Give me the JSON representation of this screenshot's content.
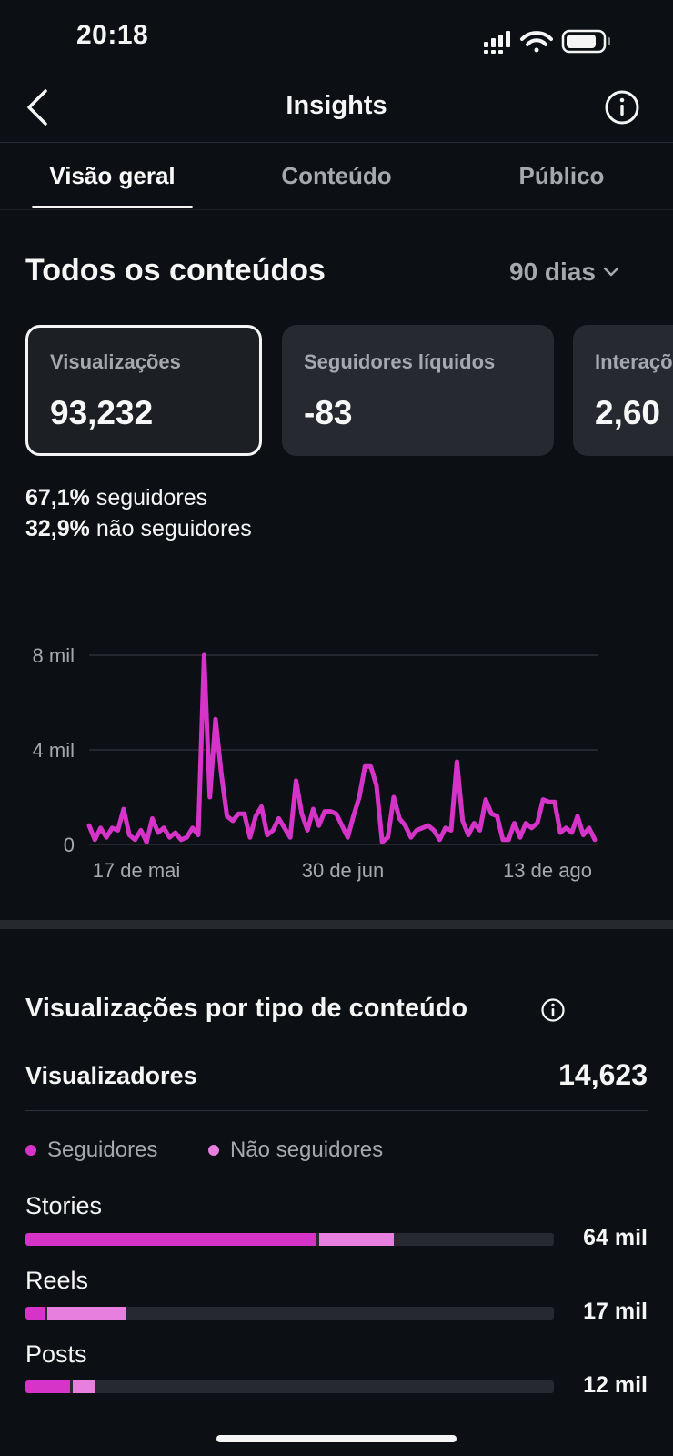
{
  "status_bar": {
    "time": "20:18"
  },
  "header": {
    "title": "Insights"
  },
  "tabs": [
    {
      "label": "Visão geral",
      "active": true
    },
    {
      "label": "Conteúdo",
      "active": false
    },
    {
      "label": "Público",
      "active": false
    }
  ],
  "overview": {
    "title": "Todos os conteúdos",
    "period": "90 dias",
    "cards": [
      {
        "label": "Visualizações",
        "value": "93,232",
        "selected": true
      },
      {
        "label": "Seguidores líquidos",
        "value": "-83",
        "selected": false
      },
      {
        "label": "Interações",
        "value": "2,60",
        "selected": false
      }
    ],
    "split": [
      {
        "pct": "67,1%",
        "text": " seguidores"
      },
      {
        "pct": "32,9%",
        "text": " não seguidores"
      }
    ]
  },
  "chart_data": {
    "type": "line",
    "color": "#d633c9",
    "y_ticks": [
      "8 mil",
      "4 mil",
      "0"
    ],
    "x_ticks": [
      "17 de mai",
      "30 de jun",
      "13 de ago"
    ],
    "ylim": [
      0,
      8000
    ],
    "grid": true,
    "values": [
      800,
      200,
      700,
      300,
      700,
      600,
      1500,
      400,
      200,
      600,
      100,
      1100,
      500,
      700,
      300,
      500,
      200,
      300,
      700,
      400,
      8000,
      2000,
      5300,
      3000,
      1200,
      1000,
      1300,
      1300,
      300,
      1200,
      1600,
      400,
      600,
      1100,
      700,
      300,
      2700,
      1300,
      600,
      1500,
      800,
      1400,
      1400,
      1300,
      800,
      300,
      1200,
      2000,
      3300,
      3300,
      2500,
      100,
      300,
      2000,
      1100,
      800,
      300,
      600,
      700,
      800,
      600,
      200,
      700,
      600,
      3500,
      1000,
      400,
      900,
      600,
      1900,
      1300,
      1200,
      200,
      200,
      900,
      300,
      900,
      700,
      900,
      1900,
      1800,
      1800,
      500,
      700,
      500,
      1200,
      400,
      700,
      200
    ]
  },
  "views_by_type": {
    "title": "Visualizações por tipo de conteúdo",
    "viewers_label": "Visualizadores",
    "viewers_value": "14,623",
    "legend": [
      {
        "label": "Seguidores",
        "color": "#d633c9"
      },
      {
        "label": "Não seguidores",
        "color": "#e67fdd"
      }
    ],
    "rows": [
      {
        "label": "Stories",
        "value": "64 mil",
        "followers_fraction": 0.551,
        "nonfollowers_fraction": 0.141
      },
      {
        "label": "Reels",
        "value": "17 mil",
        "followers_fraction": 0.036,
        "nonfollowers_fraction": 0.148
      },
      {
        "label": "Posts",
        "value": "12 mil",
        "followers_fraction": 0.084,
        "nonfollowers_fraction": 0.044
      }
    ]
  }
}
